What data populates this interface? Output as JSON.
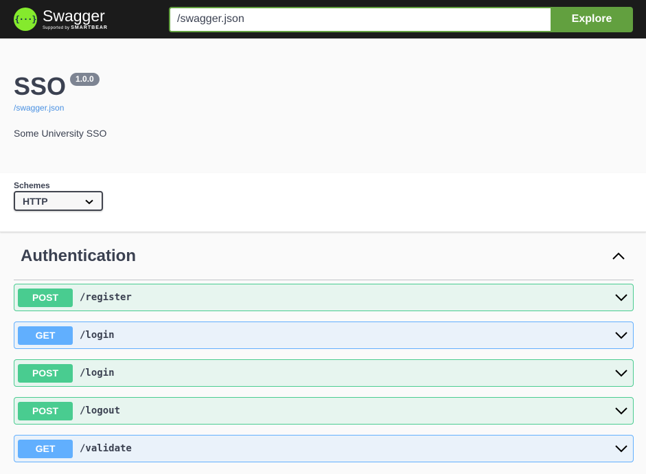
{
  "topbar": {
    "logo_badge": "{···}",
    "logo_title": "Swagger",
    "logo_sub_prefix": "Supported by",
    "logo_sub_brand": "SMARTBEAR",
    "url_value": "/swagger.json",
    "explore_label": "Explore"
  },
  "info": {
    "title": "SSO",
    "version": "1.0.0",
    "spec_link": "/swagger.json",
    "description": "Some University SSO"
  },
  "schemes": {
    "label": "Schemes",
    "selected": "HTTP"
  },
  "tag": {
    "name": "Authentication",
    "operations": [
      {
        "method": "POST",
        "path": "/register"
      },
      {
        "method": "GET",
        "path": "/login"
      },
      {
        "method": "POST",
        "path": "/login"
      },
      {
        "method": "POST",
        "path": "/logout"
      },
      {
        "method": "GET",
        "path": "/validate"
      }
    ]
  },
  "colors": {
    "topbar_bg": "#1b1b1b",
    "accent_green": "#62a03f",
    "post": "#49cc90",
    "get": "#61affe",
    "link": "#4990e2"
  }
}
